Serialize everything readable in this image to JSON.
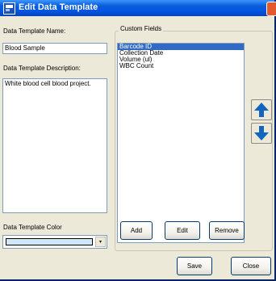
{
  "window": {
    "title": "Edit Data Template"
  },
  "template_name": {
    "label": "Data Template Name:",
    "value": "Blood Sample"
  },
  "template_description": {
    "label": "Data Template Description:",
    "value": "White blood cell blood project."
  },
  "template_color": {
    "label": "Data Template Color",
    "color": "#cfe8f7",
    "dropdown_glyph": "▾"
  },
  "custom_fields": {
    "label": "Custom Fields",
    "items": [
      "Barcode ID",
      "Collection Date",
      "Volume (ul)",
      "WBC Count"
    ],
    "selected_index": 0
  },
  "icons": {
    "move_up": "up-arrow-icon",
    "move_down": "down-arrow-icon",
    "window": "app-icon",
    "close": "close-icon"
  },
  "buttons": {
    "add": "Add",
    "edit": "Edit",
    "remove": "Remove",
    "save": "Save",
    "close": "Close"
  },
  "colors": {
    "titlebar": "#0054e3",
    "selection": "#316ac5",
    "arrow": "#1565c0",
    "dialog_bg": "#ece9d8"
  }
}
